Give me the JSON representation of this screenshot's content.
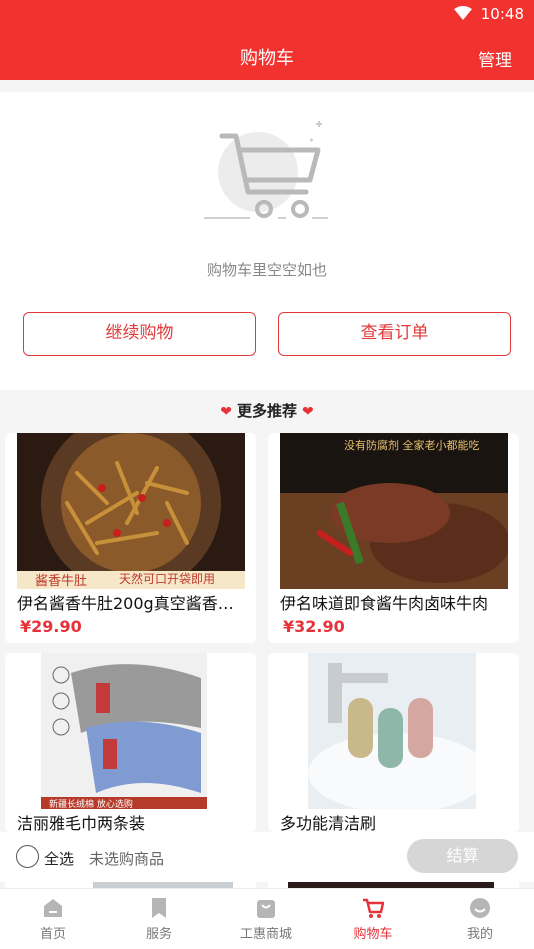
{
  "status_bar": {
    "time": "10:48"
  },
  "header": {
    "title": "购物车",
    "manage_label": "管理"
  },
  "empty_state": {
    "message": "购物车里空空如也",
    "continue_label": "继续购物",
    "orders_label": "查看订单"
  },
  "recommend": {
    "title": "更多推荐"
  },
  "products": [
    {
      "name": "伊名酱香牛肚200g真空酱香牛肚",
      "price": "¥29.90",
      "image_text": "酱香牛肚",
      "image_text2": "天然可口开袋即用"
    },
    {
      "name": "伊名味道即食酱牛肉卤味牛肉",
      "price": "¥32.90",
      "image_text": "没有防腐剂 全家老小都能吃"
    },
    {
      "name": "洁丽雅毛巾两条装",
      "price": "",
      "image_text": "新疆长绒棉 放心选购"
    },
    {
      "name": "多功能清洁刷",
      "price": ""
    }
  ],
  "checkout": {
    "select_all_label": "全选",
    "none_selected_label": "未选购商品",
    "checkout_label": "结算"
  },
  "tabs": [
    {
      "label": "首页",
      "icon": "home-icon",
      "active": false
    },
    {
      "label": "服务",
      "icon": "bookmark-icon",
      "active": false
    },
    {
      "label": "工惠商城",
      "icon": "bag-icon",
      "active": false
    },
    {
      "label": "购物车",
      "icon": "cart-icon",
      "active": true
    },
    {
      "label": "我的",
      "icon": "user-icon",
      "active": false
    }
  ],
  "colors": {
    "accent": "#f2322f",
    "price": "#e8323a",
    "checkout_disabled": "#d6d6d6"
  }
}
